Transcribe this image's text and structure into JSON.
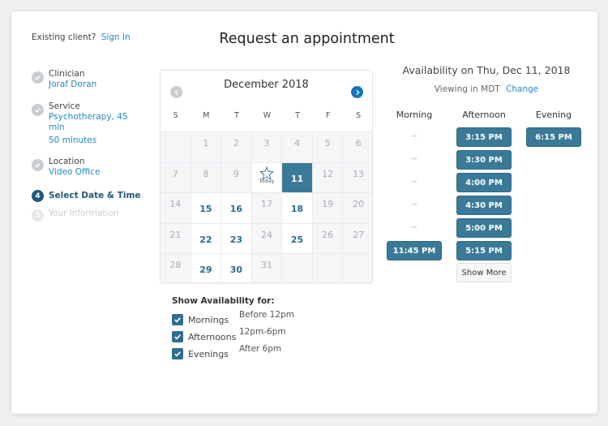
{
  "header": {
    "existing_client": "Existing client?",
    "sign_in": "Sign In",
    "title": "Request an appointment"
  },
  "steps": [
    {
      "label": "Clinician",
      "value": "Joraf Doran",
      "status": "done"
    },
    {
      "label": "Service",
      "value": "Psychotherapy, 45",
      "value_cont": "min",
      "value2": "50 minutes",
      "status": "done"
    },
    {
      "label": "Location",
      "value": "Video Office",
      "status": "done"
    },
    {
      "number": "4",
      "label": "Select Date & Time",
      "status": "active"
    },
    {
      "number": "5",
      "label": "Your Information",
      "status": "pending"
    }
  ],
  "calendar": {
    "month_label": "December 2018",
    "prev_icon": "chevron-left-icon",
    "next_icon": "chevron-right-icon",
    "weekdays": [
      "S",
      "M",
      "T",
      "W",
      "T",
      "F",
      "S"
    ],
    "today_label": "Today",
    "weeks": [
      [
        {
          "d": ""
        },
        {
          "d": "1"
        },
        {
          "d": "2"
        },
        {
          "d": "3"
        },
        {
          "d": "4"
        },
        {
          "d": "5"
        },
        {
          "d": "6"
        }
      ],
      [
        {
          "d": "7"
        },
        {
          "d": "8"
        },
        {
          "d": "9"
        },
        {
          "d": "",
          "today": true
        },
        {
          "d": "11",
          "selected": true
        },
        {
          "d": "12"
        },
        {
          "d": "13"
        }
      ],
      [
        {
          "d": "14"
        },
        {
          "d": "15",
          "available": true
        },
        {
          "d": "16",
          "available": true
        },
        {
          "d": "17"
        },
        {
          "d": "18",
          "available": true
        },
        {
          "d": "19"
        },
        {
          "d": "20"
        }
      ],
      [
        {
          "d": "21"
        },
        {
          "d": "22",
          "available": true
        },
        {
          "d": "23",
          "available": true
        },
        {
          "d": "24"
        },
        {
          "d": "25",
          "available": true
        },
        {
          "d": "26"
        },
        {
          "d": "27"
        }
      ],
      [
        {
          "d": "28"
        },
        {
          "d": "29",
          "available": true
        },
        {
          "d": "30",
          "available": true
        },
        {
          "d": "31"
        },
        {
          "d": ""
        },
        {
          "d": ""
        },
        {
          "d": ""
        }
      ]
    ]
  },
  "availability": {
    "title": "Availability on Thu, Dec 11, 2018",
    "timezone_text": "Viewing in MDT",
    "change_label": "Change",
    "columns": {
      "morning": {
        "label": "Morning",
        "dashes": [
          "--",
          "--",
          "--",
          "--",
          "--"
        ],
        "slots": [
          "11:45 PM"
        ]
      },
      "afternoon": {
        "label": "Afternoon",
        "slots": [
          "3:15 PM",
          "3:30 PM",
          "4:00 PM",
          "4:30 PM",
          "5:00 PM",
          "5:15 PM"
        ]
      },
      "evening": {
        "label": "Evening",
        "slots": [
          "6:15 PM"
        ]
      }
    },
    "show_more": "Show More"
  },
  "filters": {
    "title": "Show Availability for:",
    "options": [
      {
        "label": "Mornings",
        "desc": "Before 12pm",
        "checked": true
      },
      {
        "label": "Afternoons",
        "desc": "12pm-6pm",
        "checked": true
      },
      {
        "label": "Evenings",
        "desc": "After 6pm",
        "checked": true
      }
    ]
  },
  "colors": {
    "accent": "#3a7a98",
    "link": "#1f8bc4",
    "next_button": "#1376bd"
  }
}
